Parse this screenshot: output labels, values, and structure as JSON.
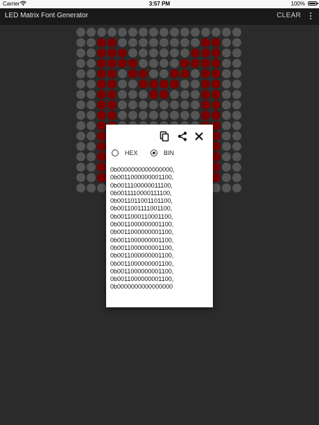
{
  "status_bar": {
    "carrier": "Carrier",
    "time": "3:57 PM",
    "battery": "100%"
  },
  "app_bar": {
    "title": "LED Matrix Font Generator",
    "clear_label": "CLEAR",
    "menu_icon": "more-vert-icon"
  },
  "matrix": {
    "rows": 16,
    "cols": 16,
    "on_color": "#7a0000",
    "off_color": "#555555",
    "pattern": [
      "0000000000000000",
      "0011000000001100",
      "0011100000011100",
      "0011110000111100",
      "0011011001101100",
      "0011001111001100",
      "0011000110001100",
      "0011000000001100",
      "0011000000001100",
      "0011000000001100",
      "0011000000001100",
      "0011000000001100",
      "0011000000001100",
      "0011000000001100",
      "0011000000001100",
      "0000000000000000"
    ]
  },
  "dialog": {
    "icons": [
      "copy-icon",
      "share-icon",
      "close-icon"
    ],
    "format_options": {
      "hex_label": "HEX",
      "bin_label": "BIN",
      "selected": "BIN"
    },
    "code_lines": [
      "0b0000000000000000,",
      "0b0011000000001100,",
      "0b0011100000011100,",
      "0b0011110000111100,",
      "0b0011011001101100,",
      "0b0011001111001100,",
      "0b0011000110001100,",
      "0b0011000000001100,",
      "0b0011000000001100,",
      "0b0011000000001100,",
      "0b0011000000001100,",
      "0b0011000000001100,",
      "0b0011000000001100,",
      "0b0011000000001100,",
      "0b0011000000001100,",
      "0b0000000000000000"
    ]
  }
}
